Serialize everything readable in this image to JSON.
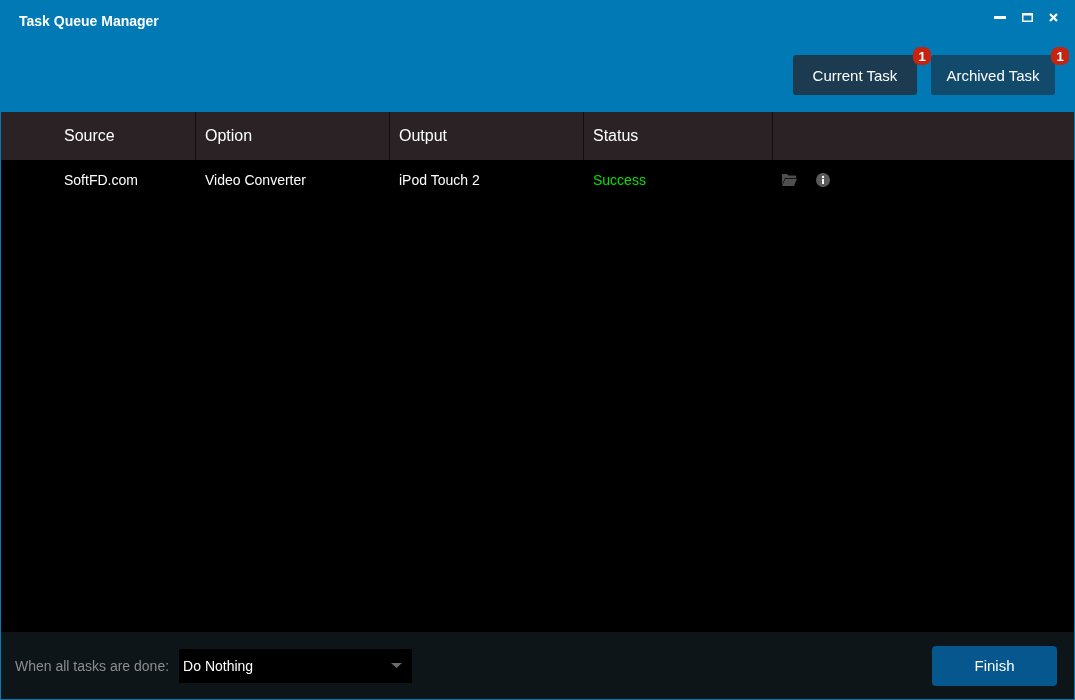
{
  "window": {
    "title": "Task Queue Manager"
  },
  "tabs": [
    {
      "label": "Current Task",
      "badge": "1",
      "selected": false
    },
    {
      "label": "Archived Task",
      "badge": "1",
      "selected": true
    }
  ],
  "table": {
    "columns": [
      "Source",
      "Option",
      "Output",
      "Status"
    ],
    "rows": [
      {
        "source": "SoftFD.com",
        "option": "Video Converter",
        "output": "iPod Touch 2",
        "status": "Success",
        "color": "#00e400"
      }
    ]
  },
  "footer": {
    "label": "When all tasks are done:",
    "select": {
      "value": "Do Nothing"
    },
    "button": "Finish"
  }
}
